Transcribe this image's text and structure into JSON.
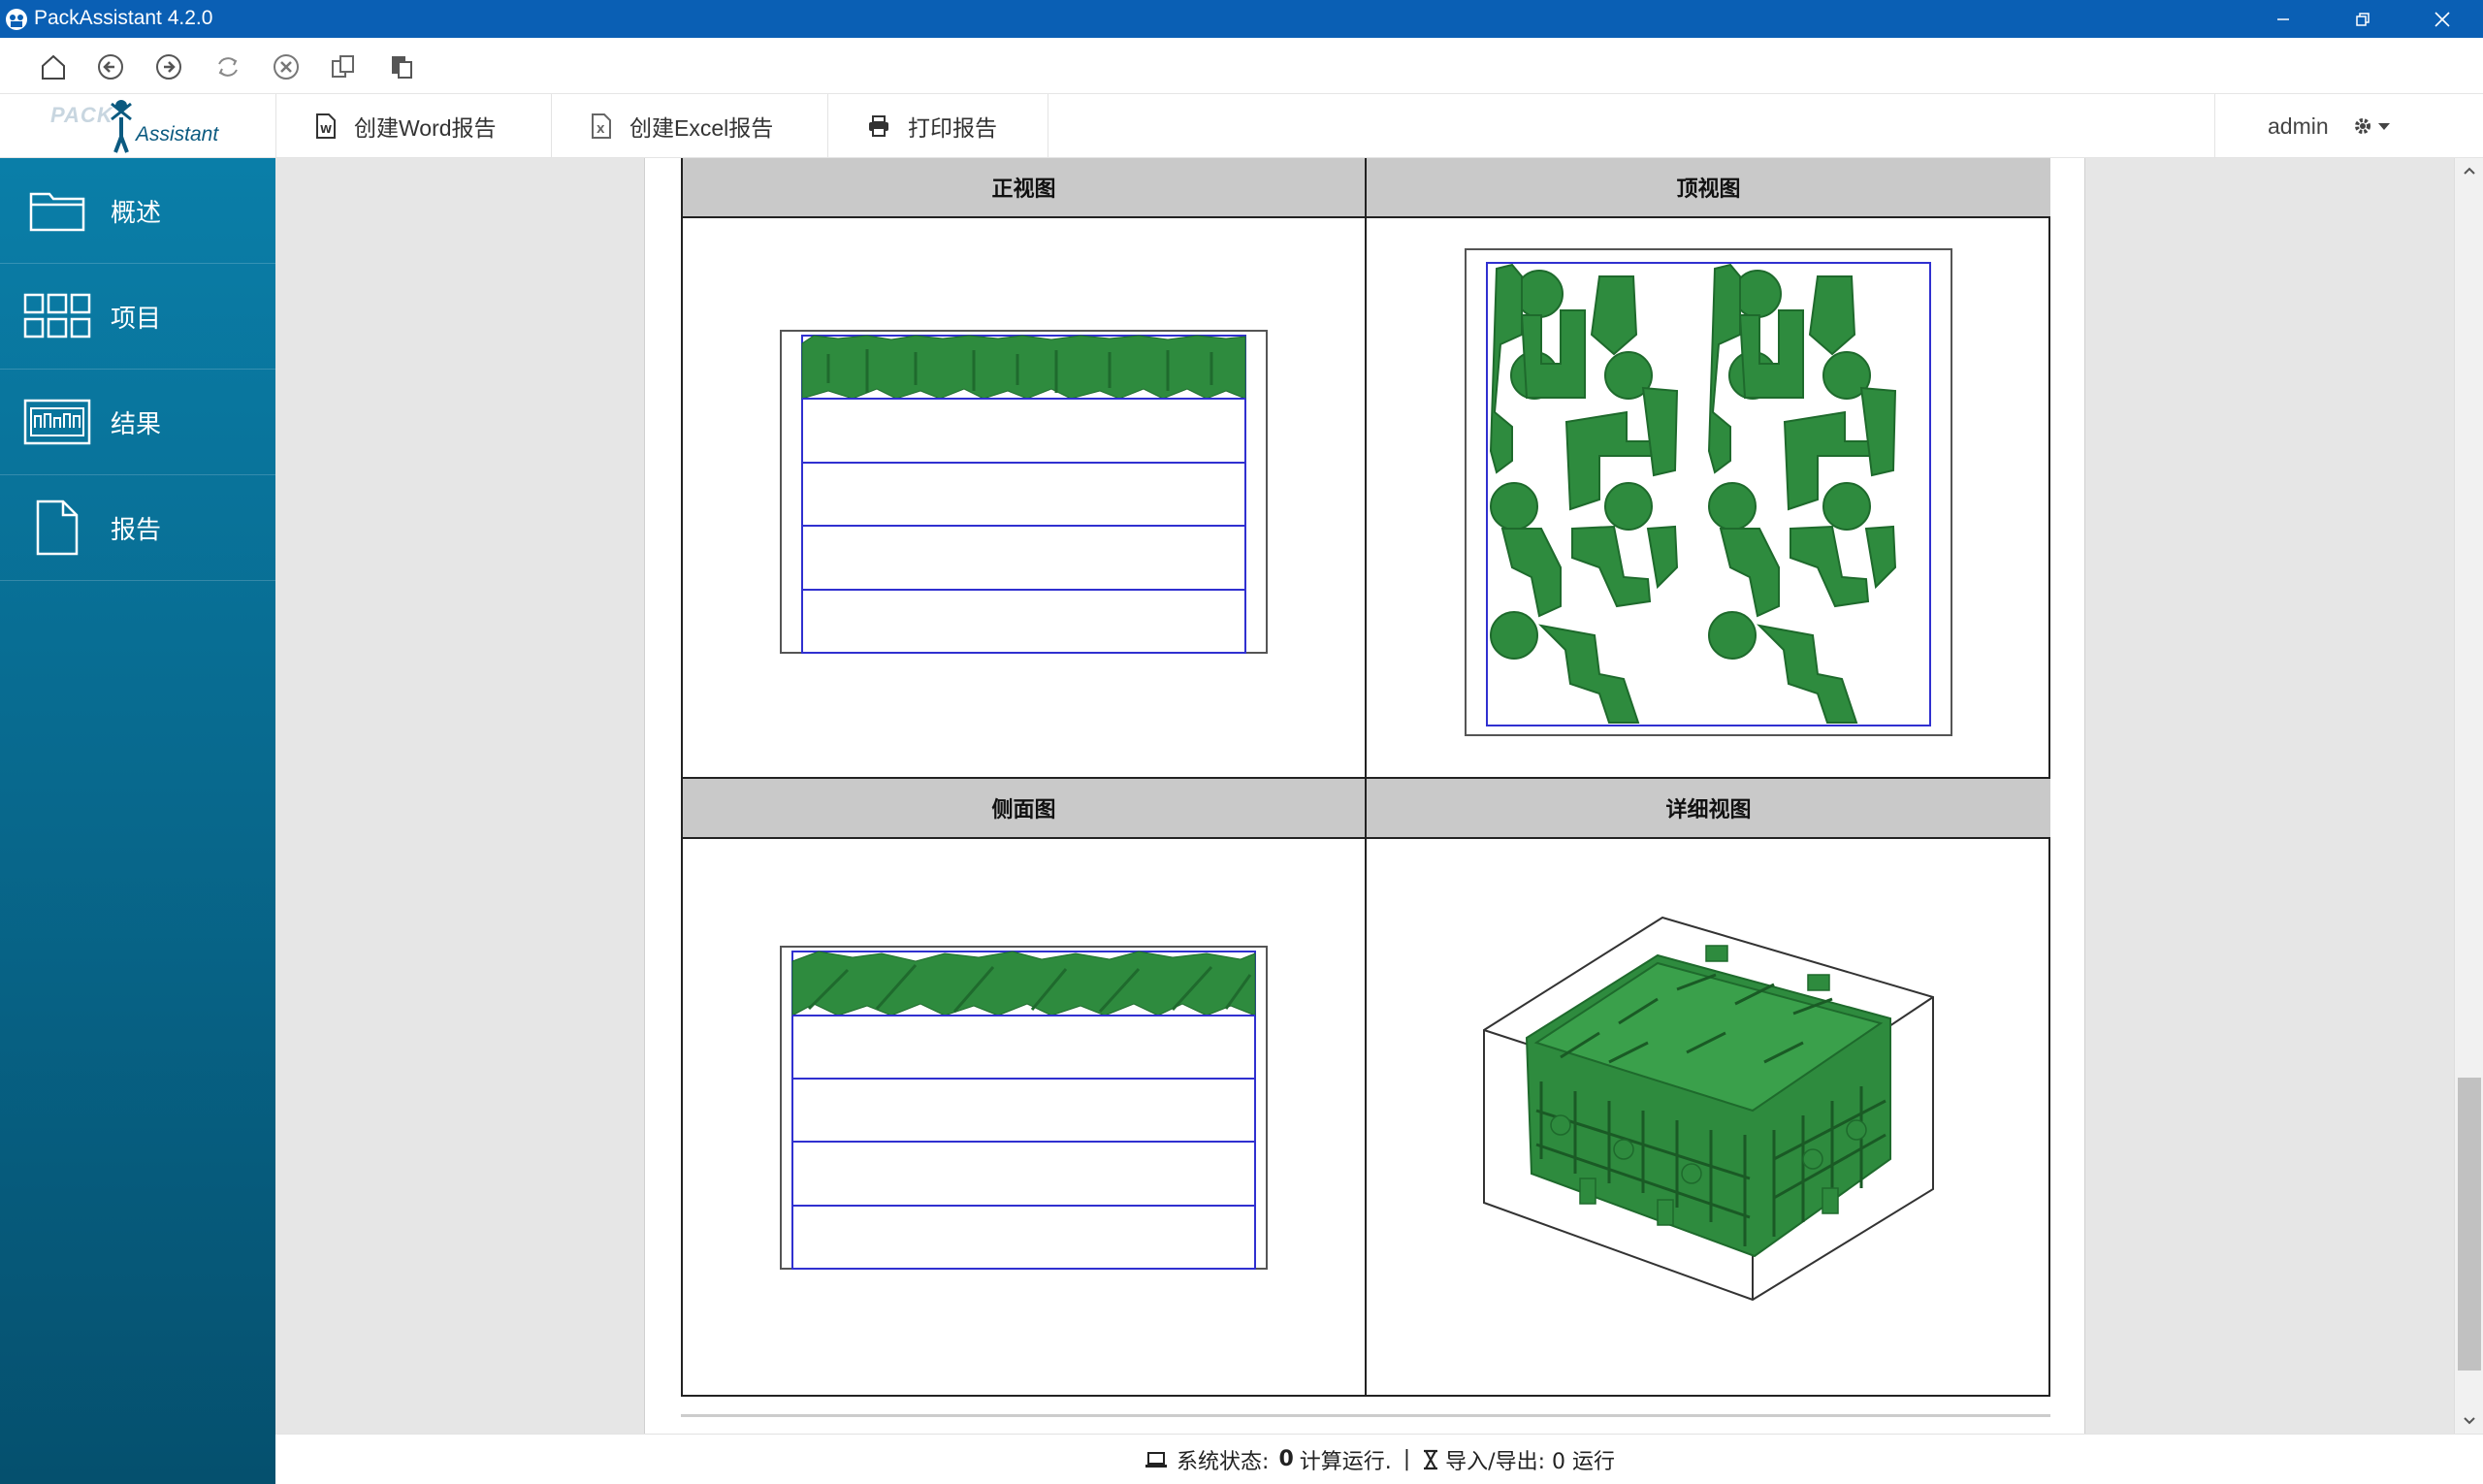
{
  "window": {
    "title": "PackAssistant 4.2.0"
  },
  "toolbar": {
    "icons": [
      "home-icon",
      "back-icon",
      "forward-icon",
      "refresh-icon",
      "stop-icon",
      "copy-icon",
      "paste-icon"
    ]
  },
  "header": {
    "logo_pack": "PACK",
    "logo_assistant": "Assistant",
    "tabs": [
      {
        "label": "创建Word报告",
        "icon": "word-icon"
      },
      {
        "label": "创建Excel报告",
        "icon": "excel-icon"
      },
      {
        "label": "打印报告",
        "icon": "print-icon"
      }
    ],
    "user": "admin"
  },
  "sidebar": {
    "items": [
      {
        "label": "概述",
        "icon": "folder-icon"
      },
      {
        "label": "项目",
        "icon": "grid-icon"
      },
      {
        "label": "结果",
        "icon": "results-icon"
      },
      {
        "label": "报告",
        "icon": "document-icon"
      }
    ]
  },
  "report": {
    "views": [
      {
        "title": "正视图"
      },
      {
        "title": "顶视图"
      },
      {
        "title": "侧面图"
      },
      {
        "title": "详细视图"
      }
    ]
  },
  "status": {
    "system_label": "系统状态:",
    "calc_count": "0",
    "calc_label": "计算运行.",
    "separator": "|",
    "io_label": "导入/导出: 0 运行"
  },
  "colors": {
    "titlebar": "#0a5fb4",
    "sidebar_top": "#0a7ea8",
    "sidebar_bottom": "#05506e",
    "part_green": "#2e8b3e",
    "layer_blue": "#3030d0"
  }
}
